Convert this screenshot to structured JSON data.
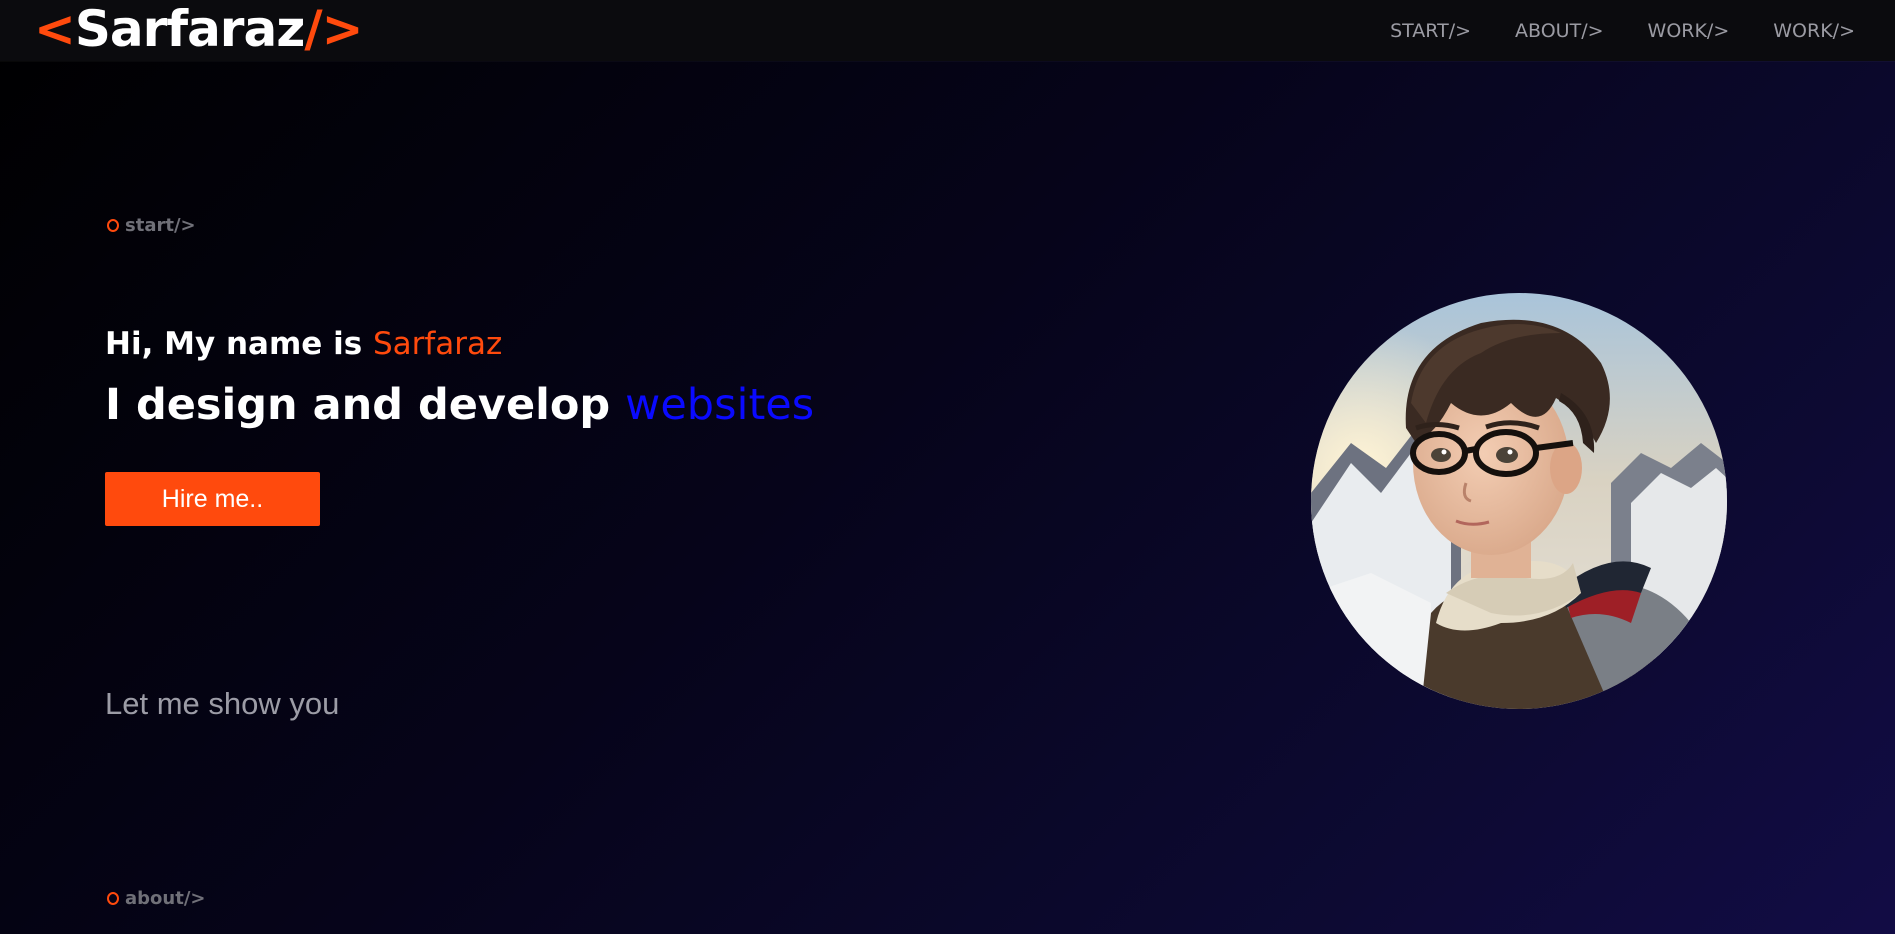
{
  "header": {
    "logo": {
      "open": "<",
      "name": "Sarfaraz",
      "close": "/>"
    },
    "nav": [
      {
        "label": "START/>"
      },
      {
        "label": "ABOUT/>"
      },
      {
        "label": "WORK/>"
      },
      {
        "label": "WORK/>"
      }
    ]
  },
  "hero": {
    "section_label": "start/>",
    "greeting_prefix": "Hi, My name is ",
    "greeting_name": "Sarfaraz",
    "headline_prefix": "I design and develop ",
    "headline_highlight": "websites",
    "cta_label": "Hire me..",
    "subtext": "Let me show you"
  },
  "about": {
    "section_label": "about/>"
  },
  "colors": {
    "accent": "#ff4a0d",
    "highlight": "#0a0aff",
    "background": "#06041a",
    "navbar": "#0b0b0e"
  },
  "icons": {
    "section_marker": "circle-outline-icon"
  }
}
